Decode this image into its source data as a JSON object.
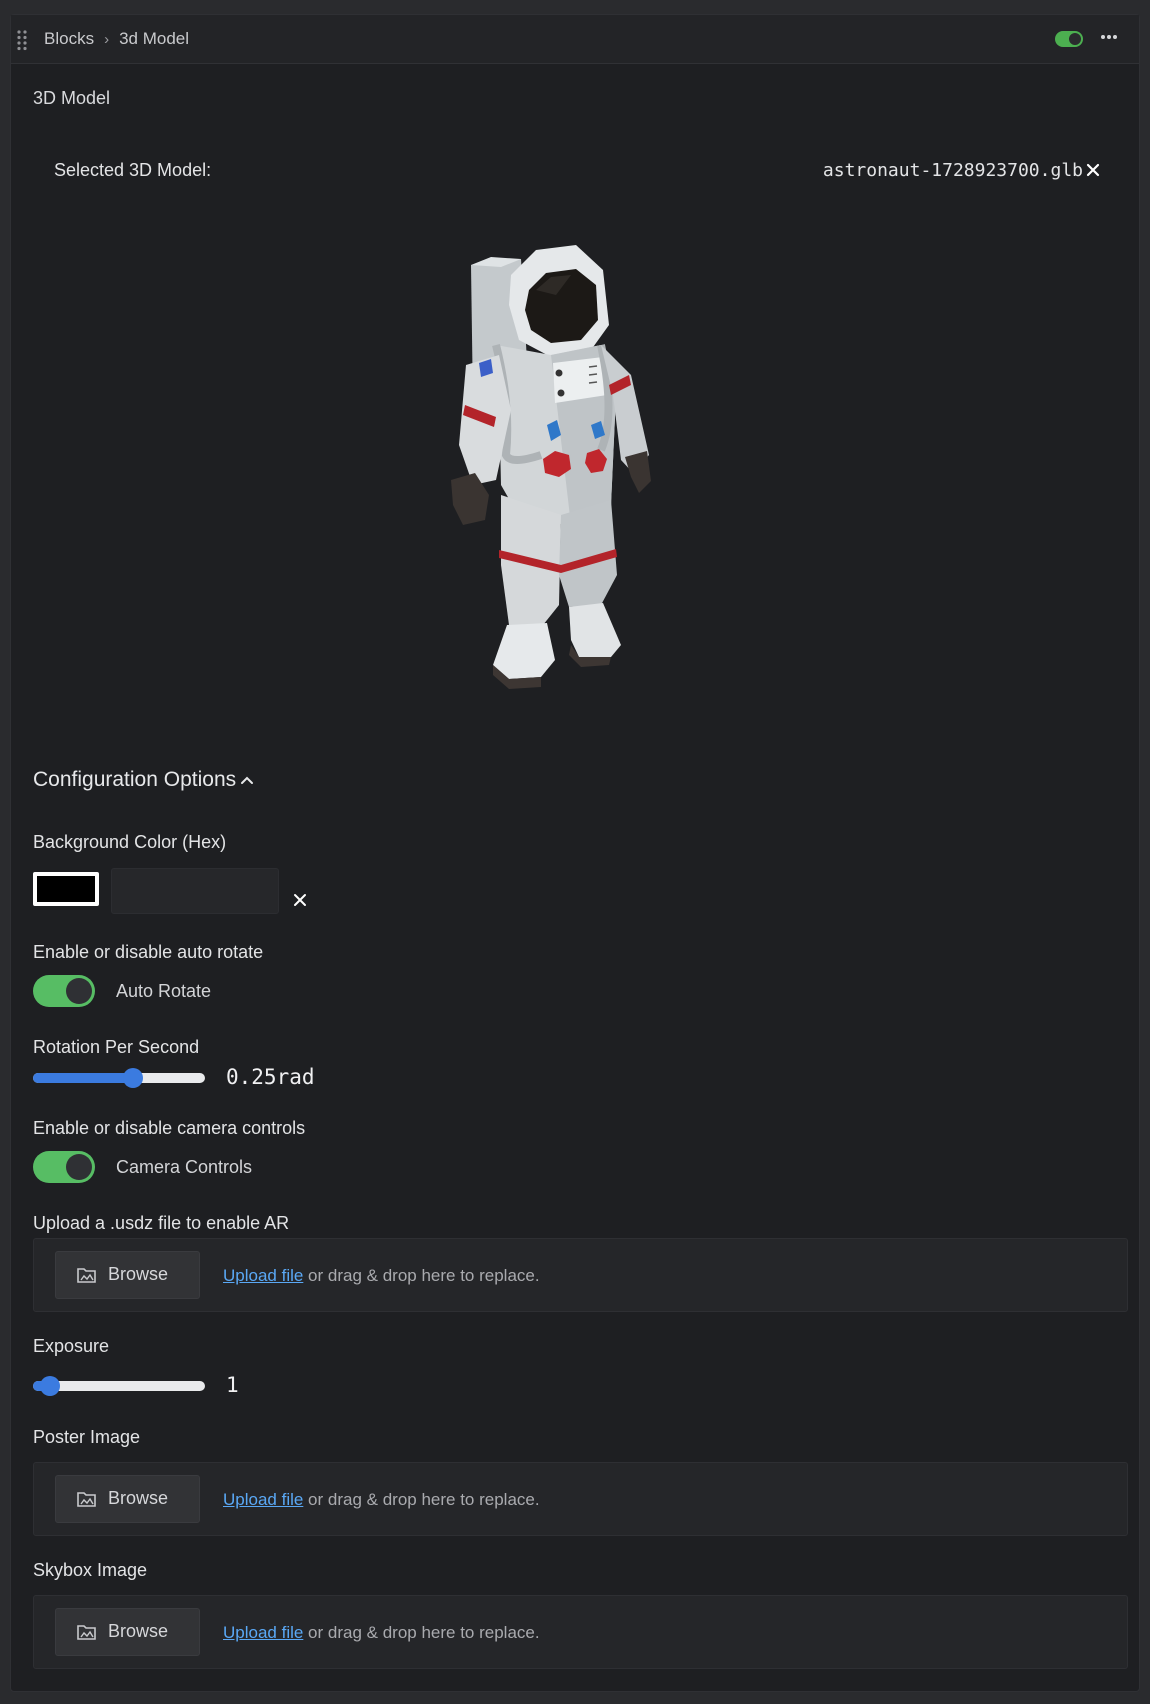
{
  "header": {
    "breadcrumb_root": "Blocks",
    "breadcrumb_current": "3d Model"
  },
  "block": {
    "section_title": "3D Model",
    "selected_label": "Selected 3D Model:",
    "selected_file": "astronaut-1728923700.glb"
  },
  "config": {
    "title": "Configuration Options",
    "background": {
      "label": "Background Color (Hex)",
      "swatch_color": "#000000",
      "value": ""
    },
    "auto_rotate": {
      "label": "Enable or disable auto rotate",
      "switch_label": "Auto Rotate"
    },
    "rotation": {
      "label": "Rotation Per Second",
      "value_text": "0.25rad",
      "fraction": 0.58
    },
    "camera": {
      "label": "Enable or disable camera controls",
      "switch_label": "Camera Controls"
    },
    "ar_upload": {
      "label": "Upload a .usdz file to enable AR",
      "browse": "Browse",
      "link": "Upload file",
      "hint": " or drag & drop here to replace."
    },
    "exposure": {
      "label": "Exposure",
      "value_text": "1",
      "fraction": 0.1
    },
    "poster": {
      "label": "Poster Image",
      "browse": "Browse",
      "link": "Upload file",
      "hint": " or drag & drop here to replace."
    },
    "skybox": {
      "label": "Skybox Image",
      "browse": "Browse",
      "link": "Upload file",
      "hint": " or drag & drop here to replace."
    }
  },
  "colors": {
    "accent_green": "#57bd64",
    "slider_blue": "#3b7be0",
    "link_blue": "#5aa8f5"
  }
}
